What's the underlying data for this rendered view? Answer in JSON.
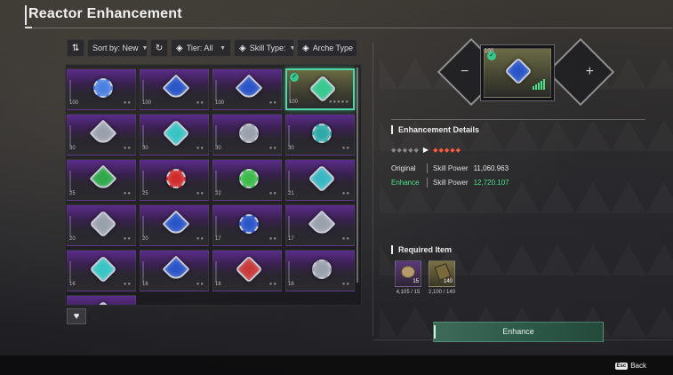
{
  "header": {
    "title": "Reactor Enhancement"
  },
  "toolbar": {
    "sort_label": "Sort by: New",
    "tier_label": "Tier: All",
    "skill_label": "Skill Type:",
    "arche_label": "Arche Type"
  },
  "grid": {
    "tiles": [
      {
        "level": "100",
        "color": "#4a7fe0",
        "shape": "star"
      },
      {
        "level": "100",
        "color": "#2a55c8",
        "shape": "tri"
      },
      {
        "level": "100",
        "color": "#2a55c8",
        "shape": "tri"
      },
      {
        "level": "100",
        "color": "#36c88f",
        "shape": "sq"
      },
      {
        "level": "30",
        "color": "#9aa0ac",
        "shape": "tri"
      },
      {
        "level": "30",
        "color": "#39c4c4",
        "shape": "sq"
      },
      {
        "level": "30",
        "color": "#9aa0ac",
        "shape": "star"
      },
      {
        "level": "30",
        "color": "#2ea8a8",
        "shape": "star"
      },
      {
        "level": "25",
        "color": "#2ea84a",
        "shape": "tri"
      },
      {
        "level": "25",
        "color": "#d02a2a",
        "shape": "star"
      },
      {
        "level": "22",
        "color": "#3cba4a",
        "shape": "star"
      },
      {
        "level": "21",
        "color": "#39b8c4",
        "shape": "sq"
      },
      {
        "level": "20",
        "color": "#9aa0ac",
        "shape": "sq"
      },
      {
        "level": "20",
        "color": "#2a55c8",
        "shape": "tri"
      },
      {
        "level": "17",
        "color": "#2a55c8",
        "shape": "star"
      },
      {
        "level": "17",
        "color": "#9aa0ac",
        "shape": "tri"
      },
      {
        "level": "16",
        "color": "#39c4c4",
        "shape": "sq"
      },
      {
        "level": "16",
        "color": "#2a55c8",
        "shape": "tri"
      },
      {
        "level": "16",
        "color": "#c83a3a",
        "shape": "sq"
      },
      {
        "level": "16",
        "color": "#9aa0ac",
        "shape": "star"
      },
      {
        "level": "",
        "color": "#9aa0ac",
        "shape": "sq"
      }
    ],
    "selected_index": 3
  },
  "slot": {
    "level": "100"
  },
  "details": {
    "section_title": "Enhancement Details",
    "original_label": "Original",
    "original_stat": "Skill Power",
    "original_value": "11,060.963",
    "enhance_label": "Enhance",
    "enhance_stat": "Skill Power",
    "enhance_value": "12,720.107"
  },
  "required": {
    "section_title": "Required Item",
    "items": [
      {
        "qty": "15",
        "count": "4,105 / 15"
      },
      {
        "qty": "140",
        "count": "2,100 / 140"
      }
    ]
  },
  "enhance_button": "Enhance",
  "footer": {
    "key": "Esc",
    "back_label": "Back"
  },
  "colors": {
    "accent_green": "#49e08b",
    "selected_border": "#4fd9a8",
    "star_red": "#ff5a3c"
  }
}
